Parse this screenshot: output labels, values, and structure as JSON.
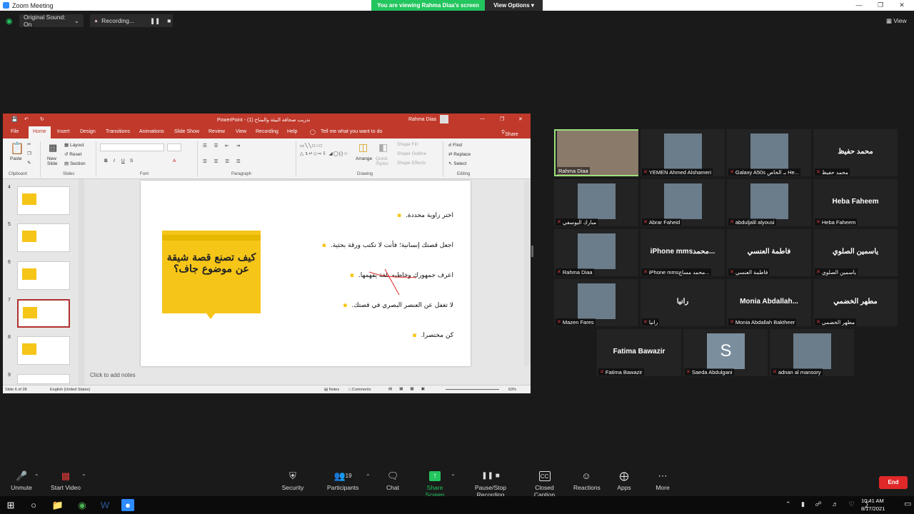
{
  "window": {
    "title": "Zoom Meeting"
  },
  "banner": {
    "viewing": "You are viewing Rahma Diaa's screen",
    "view_options": "View Options"
  },
  "status": {
    "original_sound": "Original Sound: On",
    "recording": "Recording...",
    "view": "View"
  },
  "ppt": {
    "title": "تدريب صحافة البيئة والمناخ (1) - PowerPoint",
    "user": "Rahma Diaa",
    "share": "Share",
    "tabs": [
      "File",
      "Home",
      "Insert",
      "Design",
      "Transitions",
      "Animations",
      "Slide Show",
      "Review",
      "View",
      "Recording",
      "Help"
    ],
    "tell_me": "Tell me what you want to do",
    "ribbon": {
      "paste": "Paste",
      "new_slide": "New Slide",
      "layout": "Layout",
      "reset": "Reset",
      "section": "Section",
      "arrange": "Arrange",
      "quick_styles": "Quick Styles",
      "shape_fill": "Shape Fill",
      "shape_outline": "Shape Outline",
      "shape_effects": "Shape Effects",
      "find": "Find",
      "replace": "Replace",
      "select": "Select",
      "groups": [
        "Clipboard",
        "Slides",
        "Font",
        "Paragraph",
        "Drawing",
        "Editing"
      ]
    },
    "thumbnail_numbers": [
      "4",
      "5",
      "6",
      "7",
      "8",
      "9"
    ],
    "slide": {
      "title": "كيف تصنع قصة شيقة عن موضوع جاف؟",
      "bullets": [
        "اختر زاوية محددة.",
        "اجعل قصتك إنسانية؛ فأنت لا تكتب ورقة بحثية.",
        "اعرف جمهورك وخاطبه بلغة يفهمها.",
        "لا تغفل عن العنصر البصري في قصتك.",
        "كن مختصرا."
      ]
    },
    "notes": "Click to add notes",
    "statusbar": {
      "slide": "Slide 6 of 28",
      "language": "English (United States)",
      "notes": "Notes",
      "comments": "Comments",
      "zoom": "63%"
    }
  },
  "participants": [
    {
      "name": "Rahma Diaa",
      "bigname": "",
      "photo": true,
      "muted": false,
      "active": true
    },
    {
      "name": "YEMEN Ahmed Alshameri",
      "bigname": "",
      "photo": true,
      "muted": true
    },
    {
      "name": "Galaxy A50s بـ الخاص He...",
      "bigname": "",
      "photo": true,
      "muted": true
    },
    {
      "name": "محمد حفيظ",
      "bigname": "محمد حفيظ",
      "photo": false,
      "muted": true
    },
    {
      "name": "مبارك اليوسفي",
      "bigname": "",
      "photo": true,
      "muted": true
    },
    {
      "name": "Abrar Faheid",
      "bigname": "",
      "photo": true,
      "muted": true
    },
    {
      "name": "abduljalil alyousi",
      "bigname": "",
      "photo": true,
      "muted": true
    },
    {
      "name": "Heba Faheem",
      "bigname": "Heba Faheem",
      "photo": false,
      "muted": true
    },
    {
      "name": "Rahma Diaa",
      "bigname": "",
      "photo": true,
      "muted": true
    },
    {
      "name": "iPhone mmsمحمد مساع...",
      "bigname": "iPhone mmsمحمد...",
      "photo": false,
      "muted": true
    },
    {
      "name": "فاطمة العنسي",
      "bigname": "فاطمة العنسي",
      "photo": false,
      "muted": true
    },
    {
      "name": "ياسمين الصلوي",
      "bigname": "ياسمين الصلوي",
      "photo": false,
      "muted": true
    },
    {
      "name": "Mazen Fares",
      "bigname": "",
      "photo": true,
      "muted": true
    },
    {
      "name": "رانيا",
      "bigname": "رانيا",
      "photo": false,
      "muted": true
    },
    {
      "name": "Monia Abdallah Baktheer",
      "bigname": "Monia Abdallah...",
      "photo": false,
      "muted": true
    },
    {
      "name": "مطهر الخضمي",
      "bigname": "مطهر الخضمي",
      "photo": false,
      "muted": true
    },
    {
      "name": "Fatima Bawazir",
      "bigname": "Fatima Bawazir",
      "photo": false,
      "muted": true
    },
    {
      "name": "Saeda Abdulgani",
      "bigname": "",
      "photo": true,
      "muted": true,
      "initial": "S"
    },
    {
      "name": "adnan al mansory",
      "bigname": "",
      "photo": true,
      "muted": true
    }
  ],
  "toolbar": {
    "unmute": "Unmute",
    "start_video": "Start Video",
    "security": "Security",
    "participants": "Participants",
    "participants_count": "19",
    "chat": "Chat",
    "share_screen": "Share Screen",
    "pause_recording": "Pause/Stop Recording",
    "closed_caption": "Closed Caption",
    "reactions": "Reactions",
    "apps": "Apps",
    "more": "More",
    "end": "End"
  },
  "taskbar": {
    "time": "10:41 AM",
    "date": "8/17/2021"
  },
  "colors": {
    "accent_green": "#23c55e",
    "ppt_red": "#c0392b",
    "end_red": "#e02828",
    "slide_yellow": "#f5c518"
  }
}
